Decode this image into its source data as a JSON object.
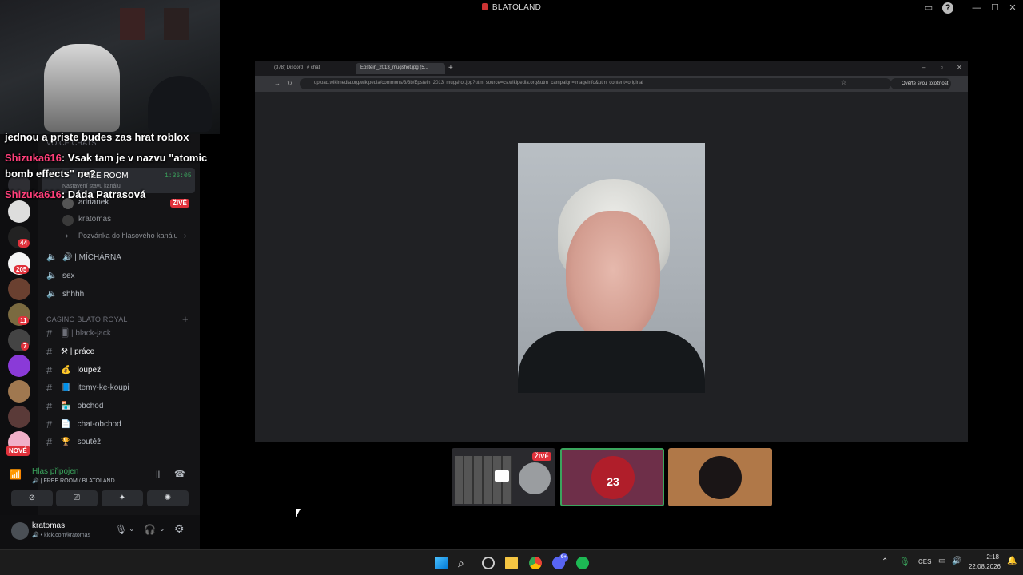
{
  "window": {
    "title": "BLATOLAND"
  },
  "chat_overlay": [
    {
      "user": "",
      "text": "jednou a priste budes zas hrat roblox"
    },
    {
      "user": "Shizuka616",
      "text": ": Vsak tam je v nazvu \"atomic"
    },
    {
      "user": "",
      "text": "bomb effects\" ne?"
    },
    {
      "user": "Shizuka616",
      "text": ": Dáda Patrasová"
    }
  ],
  "sidebar": {
    "voice_chats_label": "VOICE CHATS",
    "free_room": {
      "name": "FREE ROOM",
      "timer": "1:36:05",
      "status_hint": "Nastavení stavu kanálu"
    },
    "members": [
      {
        "name": "adrianek",
        "live_badge": "ŽIVĚ"
      },
      {
        "name": "kratomas"
      }
    ],
    "invite_label": "Pozvánka do hlasového kanálu",
    "voice_channels": [
      "MÍCHÁRNA",
      "sex",
      "shhhh"
    ],
    "casino_category": "CASINO BLATO ROYAL",
    "text_channels": [
      "black-jack",
      "práce",
      "loupež",
      "itemy-ke-koupi",
      "obchod",
      "chat-obchod",
      "soutěž"
    ],
    "server_badges": [
      "44",
      "205",
      "11",
      "7"
    ],
    "new_badge": "NOVÉ"
  },
  "voice_panel": {
    "status": "Hlas připojen",
    "location": "FREE ROOM / BLATOLAND"
  },
  "user_panel": {
    "username": "kratomas",
    "subtext": "kick.com/kratomas"
  },
  "browser": {
    "tabs": [
      {
        "label": "(378) Discord | # chat"
      },
      {
        "label": "Epstein_2013_mugshot.jpg (5..."
      }
    ],
    "url": "upload.wikimedia.org/wikipedia/commons/3/3b/Epstein_2013_mugshot.jpg?utm_source=cs.wikipedia.org&utm_campaign=imageinfo&utm_content=original",
    "verify_button": "Ověřte svou totožnost"
  },
  "stream_tiles": {
    "live_badge": "ŽIVĚ",
    "jersey_number": "23"
  },
  "taskbar": {
    "lang": "CES",
    "time": "2:18",
    "date": "22.08.2026",
    "discord_badge": "9+"
  }
}
